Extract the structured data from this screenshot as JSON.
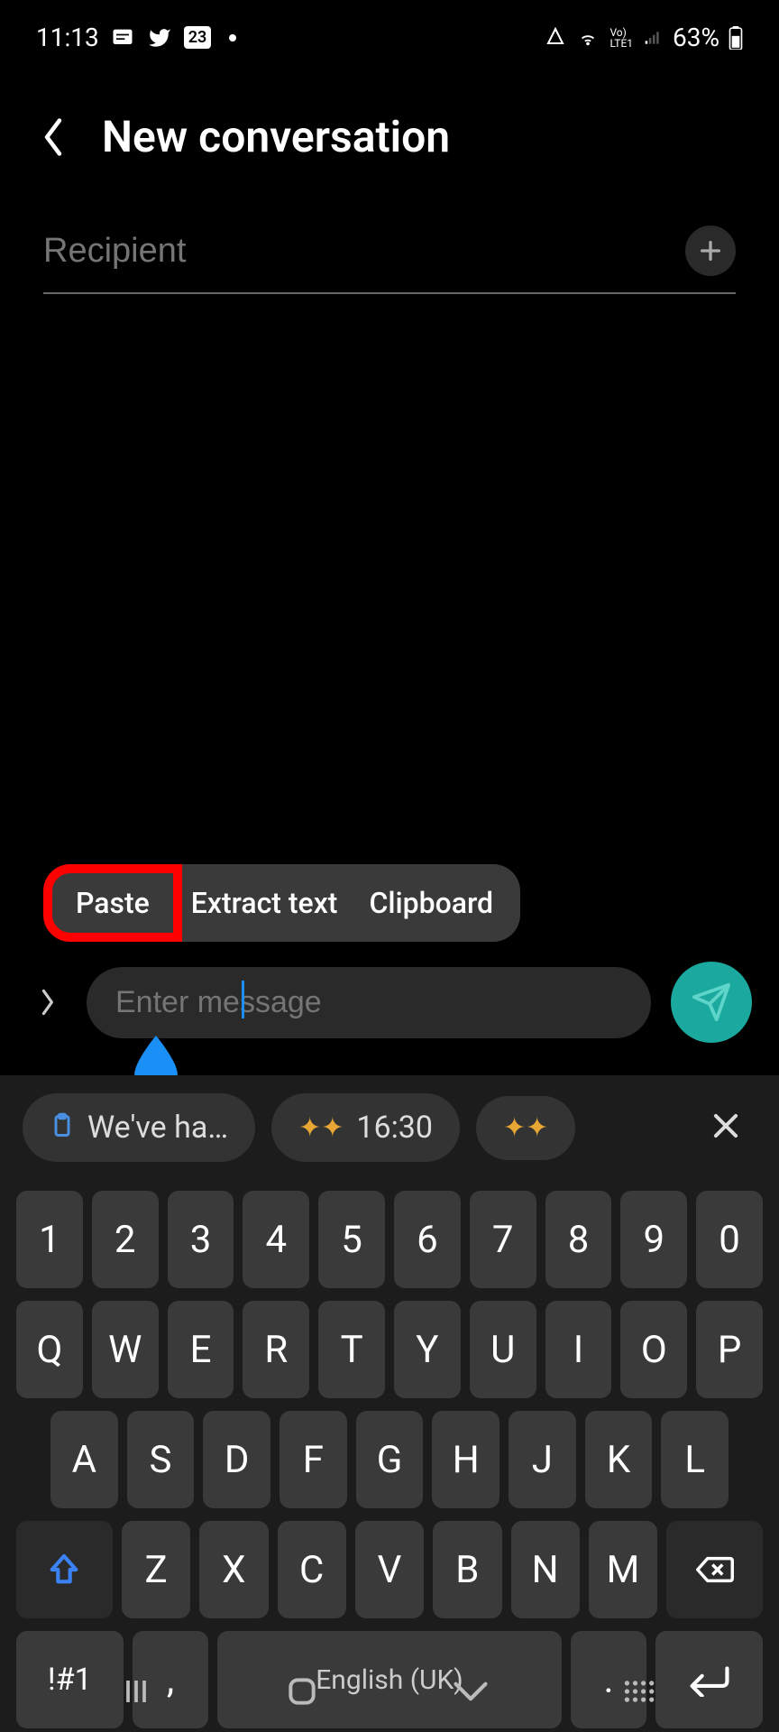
{
  "status_bar": {
    "time": "11:13",
    "calendar_badge": "23",
    "battery_text": "63%"
  },
  "header": {
    "title": "New conversation"
  },
  "recipient": {
    "placeholder": "Recipient"
  },
  "context_menu": {
    "paste": "Paste",
    "extract": "Extract text",
    "clipboard": "Clipboard"
  },
  "message_input": {
    "placeholder": "Enter message"
  },
  "keyboard": {
    "suggestions": {
      "sugg1": "We've ha…",
      "sugg2": "16:30"
    },
    "row_numbers": [
      "1",
      "2",
      "3",
      "4",
      "5",
      "6",
      "7",
      "8",
      "9",
      "0"
    ],
    "row_q": [
      "Q",
      "W",
      "E",
      "R",
      "T",
      "Y",
      "U",
      "I",
      "O",
      "P"
    ],
    "row_a": [
      "A",
      "S",
      "D",
      "F",
      "G",
      "H",
      "J",
      "K",
      "L"
    ],
    "row_z": [
      "Z",
      "X",
      "C",
      "V",
      "B",
      "N",
      "M"
    ],
    "symbols_key": "!#1",
    "comma_key": ",",
    "space_label": "English (UK)",
    "period_key": "."
  }
}
